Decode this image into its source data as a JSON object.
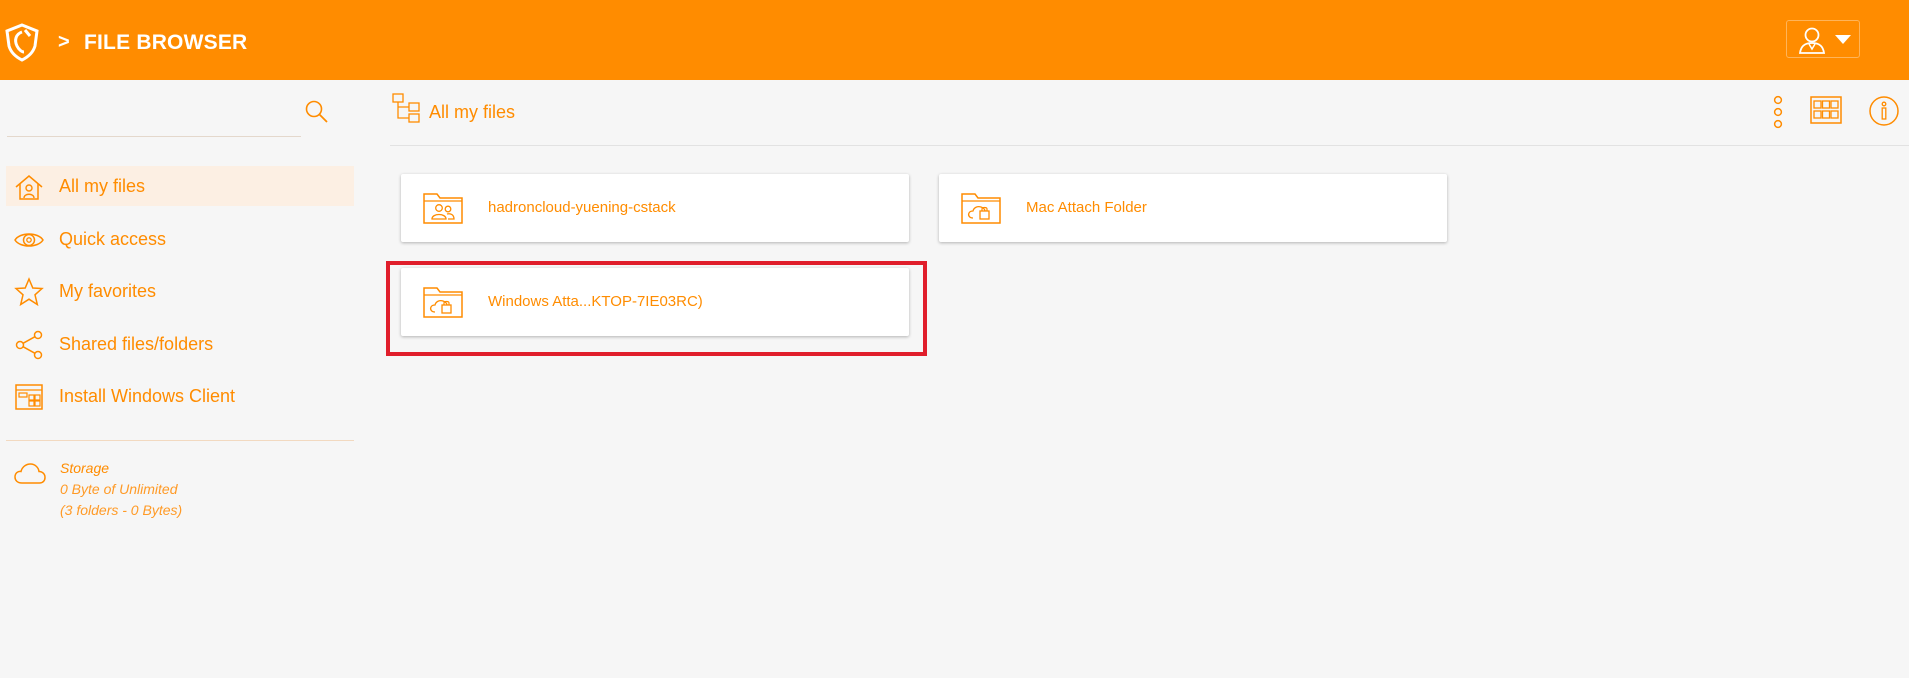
{
  "header": {
    "breadcrumb_separator": ">",
    "title": "FILE BROWSER",
    "logo_icon": "shield-logo-icon",
    "user_icon": "user-icon"
  },
  "colors": {
    "accent": "#ff8c00",
    "highlight": "#e01e2b",
    "background": "#f6f6f6"
  },
  "sidebar": {
    "search": {
      "value": "",
      "placeholder": "",
      "icon": "search-icon"
    },
    "items": [
      {
        "label": "All my files",
        "icon": "home-icon",
        "active": true
      },
      {
        "label": "Quick access",
        "icon": "eye-icon",
        "active": false
      },
      {
        "label": "My favorites",
        "icon": "star-icon",
        "active": false
      },
      {
        "label": "Shared files/folders",
        "icon": "share-icon",
        "active": false
      },
      {
        "label": "Install Windows Client",
        "icon": "windows-client-icon",
        "active": false
      }
    ],
    "storage": {
      "icon": "cloud-icon",
      "title": "Storage",
      "usage": "0 Byte of Unlimited",
      "summary": "(3 folders - 0 Bytes)"
    }
  },
  "main": {
    "title": "All my files",
    "title_icon": "folder-tree-icon",
    "toolbar": [
      "more-options-icon",
      "grid-view-icon",
      "info-icon"
    ],
    "folders": [
      {
        "name": "hadroncloud-yuening-cstack",
        "icon": "shared-folder-icon"
      },
      {
        "name": "Mac Attach Folder",
        "icon": "cloud-folder-icon"
      },
      {
        "name": "Windows Atta...KTOP-7IE03RC)",
        "icon": "cloud-folder-icon",
        "highlighted": true
      }
    ]
  }
}
